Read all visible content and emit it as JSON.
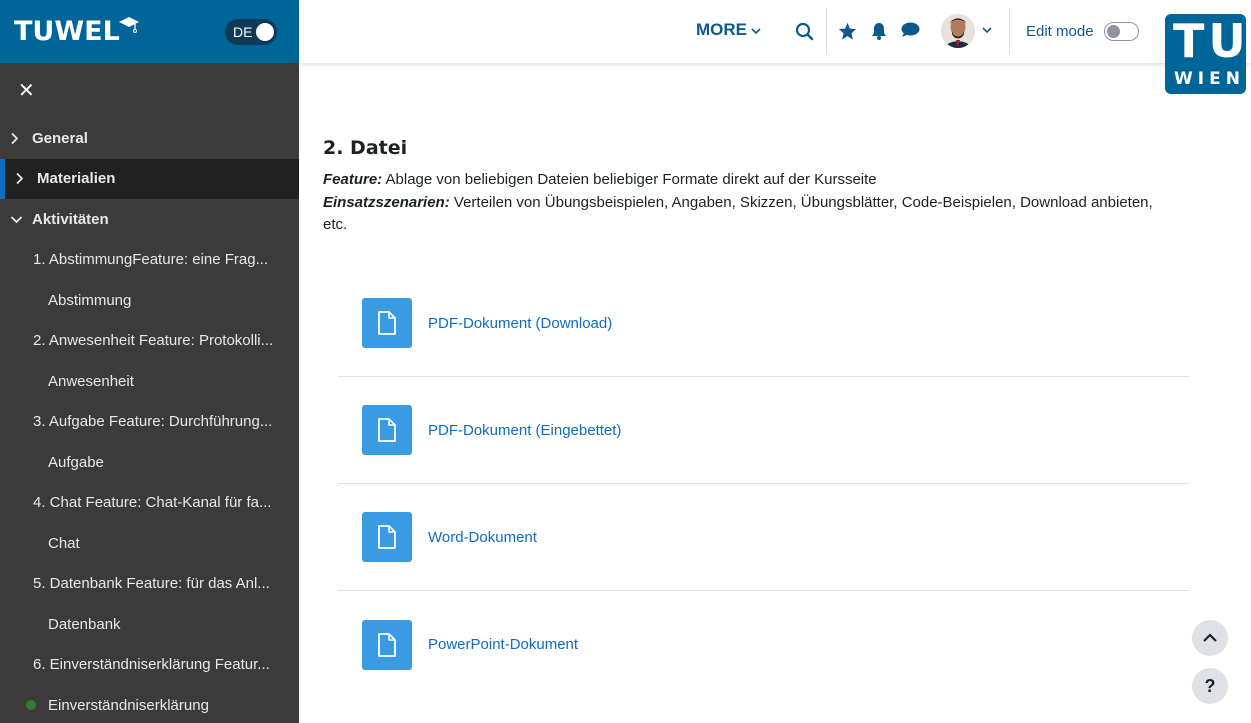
{
  "brand": {
    "logo_text": "TUWEL",
    "lang": "DE"
  },
  "sidebar": {
    "close_label": "✕",
    "items": [
      {
        "label": "General",
        "type": "section",
        "expanded": false
      },
      {
        "label": "Materialien",
        "type": "section",
        "expanded": false,
        "active": true
      },
      {
        "label": "Aktivitäten",
        "type": "section",
        "expanded": true
      },
      {
        "label": "1. AbstimmungFeature: eine Frag...",
        "type": "sub"
      },
      {
        "label": "Abstimmung",
        "type": "subsub"
      },
      {
        "label": "2. Anwesenheit Feature: Protokolli...",
        "type": "sub"
      },
      {
        "label": "Anwesenheit",
        "type": "subsub"
      },
      {
        "label": "3. Aufgabe Feature: Durchführung...",
        "type": "sub"
      },
      {
        "label": "Aufgabe",
        "type": "subsub"
      },
      {
        "label": "4. Chat Feature: Chat-Kanal für fa...",
        "type": "sub"
      },
      {
        "label": "Chat",
        "type": "subsub"
      },
      {
        "label": "5. Datenbank Feature: für das Anl...",
        "type": "sub"
      },
      {
        "label": "Datenbank",
        "type": "subsub"
      },
      {
        "label": "6. Einverständniserklärung Featur...",
        "type": "sub"
      },
      {
        "label": "Einverständniserklärung",
        "type": "subsub",
        "completed": true
      }
    ]
  },
  "topbar": {
    "more_label": "MORE",
    "edit_mode_label": "Edit mode",
    "edit_mode_on": false,
    "tu_logo_top": "TU",
    "tu_logo_bottom": "WIEN"
  },
  "main": {
    "section_title": "2. Datei",
    "feature_label": "Feature:",
    "feature_text": " Ablage von beliebigen Dateien beliebiger Formate direkt auf der Kursseite",
    "scenario_label": "Einsatzszenarien:",
    "scenario_text": " Verteilen von Übungsbeispielen, Angaben, Skizzen, Übungsblätter, Code-Beispielen, Download anbieten, etc.",
    "activities": [
      {
        "label": "PDF-Dokument (Download)"
      },
      {
        "label": "PDF-Dokument (Eingebettet)"
      },
      {
        "label": "Word-Dokument"
      },
      {
        "label": "PowerPoint-Dokument"
      }
    ]
  },
  "floating": {
    "help_label": "?"
  },
  "colors": {
    "brand": "#006699",
    "sidebar_bg": "#3b3b3b",
    "link": "#0f6cbf",
    "activity_icon": "#399be2"
  }
}
